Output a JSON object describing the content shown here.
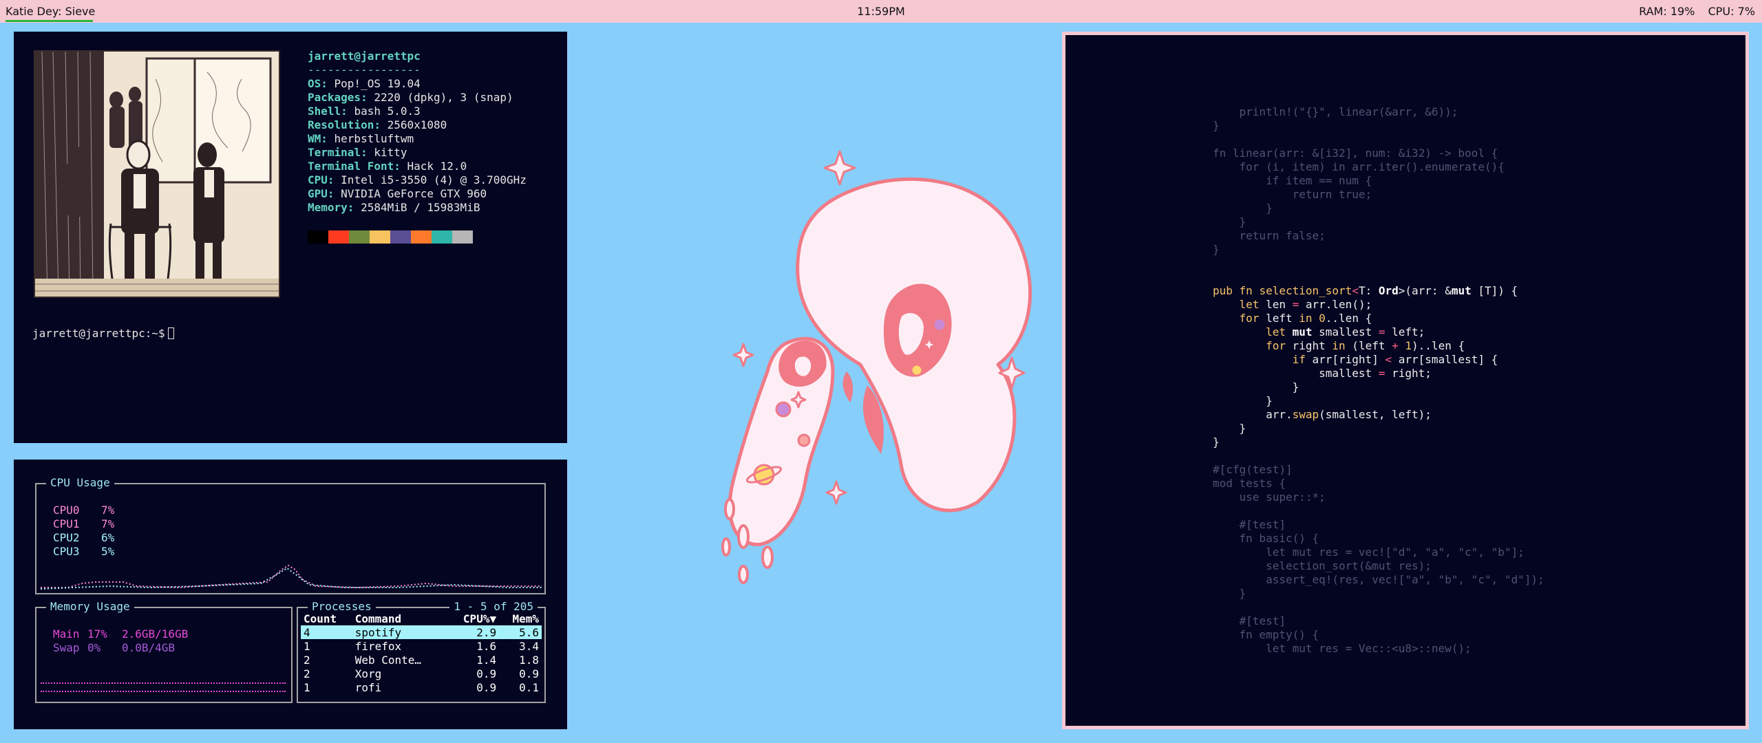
{
  "topbar": {
    "window_title": "Katie Dey: Sieve",
    "clock": "11:59PM",
    "ram": "RAM: 19%",
    "cpu": "CPU:  7%"
  },
  "neofetch": {
    "user_host": "jarrett@jarrettpc",
    "separator": "-----------------",
    "fields": [
      {
        "key": "OS",
        "value": "Pop!_OS 19.04"
      },
      {
        "key": "Packages",
        "value": "2220 (dpkg), 3 (snap)"
      },
      {
        "key": "Shell",
        "value": "bash 5.0.3"
      },
      {
        "key": "Resolution",
        "value": "2560x1080"
      },
      {
        "key": "WM",
        "value": "herbstluftwm"
      },
      {
        "key": "Terminal",
        "value": "kitty"
      },
      {
        "key": "Terminal Font",
        "value": "Hack 12.0"
      },
      {
        "key": "CPU",
        "value": "Intel i5-3550 (4) @ 3.700GHz"
      },
      {
        "key": "GPU",
        "value": "NVIDIA GeForce GTX 960"
      },
      {
        "key": "Memory",
        "value": "2584MiB / 15983MiB"
      }
    ],
    "palette": [
      "#000000",
      "#ff3b1f",
      "#6f8a3a",
      "#f6c35f",
      "#5a4e94",
      "#ff7a2a",
      "#2fb6a8",
      "#b6b6b6"
    ],
    "prompt": "jarrett@jarrettpc:~$"
  },
  "gotop": {
    "cpu_title": "CPU Usage",
    "cpus": [
      {
        "name": "CPU0",
        "value": "7%",
        "color": "#ff8ad3"
      },
      {
        "name": "CPU1",
        "value": "7%",
        "color": "#ff8ad3"
      },
      {
        "name": "CPU2",
        "value": "6%",
        "color": "#a5f2fa"
      },
      {
        "name": "CPU3",
        "value": "5%",
        "color": "#a5f2fa"
      }
    ],
    "mem_title": "Memory Usage",
    "mem": [
      {
        "name": "Main",
        "pct": "17%",
        "amount": "2.6GB/16GB",
        "color": "#e84bd8"
      },
      {
        "name": "Swap",
        "pct": "0%",
        "amount": "0.0B/4GB",
        "color": "#a75ad8"
      }
    ],
    "proc_title": "Processes",
    "proc_range": "1 - 5 of 205",
    "proc_headers": [
      "Count",
      "Command",
      "CPU%▼",
      "Mem%"
    ],
    "procs": [
      {
        "count": "4",
        "command": "spotify",
        "cpu": "2.9",
        "mem": "5.6"
      },
      {
        "count": "1",
        "command": "firefox",
        "cpu": "1.6",
        "mem": "3.4"
      },
      {
        "count": "2",
        "command": "Web Conte…",
        "cpu": "1.4",
        "mem": "1.8"
      },
      {
        "count": "2",
        "command": "Xorg",
        "cpu": "0.9",
        "mem": "0.9"
      },
      {
        "count": "1",
        "command": "rofi",
        "cpu": "0.9",
        "mem": "0.1"
      }
    ]
  },
  "code": {
    "lines": [
      {
        "t": "    println!(\"{}\", linear(&arr, &6));",
        "c": "dim"
      },
      {
        "t": "}",
        "c": "dim"
      },
      {
        "t": "",
        "c": "dim"
      },
      {
        "t": "fn linear(arr: &[i32], num: &i32) -> bool {",
        "c": "dim"
      },
      {
        "t": "    for (i, item) in arr.iter().enumerate(){",
        "c": "dim"
      },
      {
        "t": "        if item == num {",
        "c": "dim"
      },
      {
        "t": "            return true;",
        "c": "dim"
      },
      {
        "t": "        }",
        "c": "dim"
      },
      {
        "t": "    }",
        "c": "dim"
      },
      {
        "t": "    return false;",
        "c": "dim"
      },
      {
        "t": "}",
        "c": "dim"
      },
      {
        "t": "",
        "c": "dim"
      },
      {
        "t": "",
        "c": "dim"
      },
      {
        "t": "pub fn selection_sort<T: Ord>(arr: &mut [T]) {",
        "c": "hl0"
      },
      {
        "t": "    let len = arr.len();",
        "c": "hl1"
      },
      {
        "t": "    for left in 0..len {",
        "c": "hl2"
      },
      {
        "t": "        let mut smallest = left;",
        "c": "hl3"
      },
      {
        "t": "        for right in (left + 1)..len {",
        "c": "hl4"
      },
      {
        "t": "            if arr[right] < arr[smallest] {",
        "c": "hl5"
      },
      {
        "t": "                smallest = right;",
        "c": "hl6"
      },
      {
        "t": "            }",
        "c": "plain"
      },
      {
        "t": "        }",
        "c": "plain"
      },
      {
        "t": "        arr.swap(smallest, left);",
        "c": "hl7"
      },
      {
        "t": "    }",
        "c": "plain"
      },
      {
        "t": "}",
        "c": "plain"
      },
      {
        "t": "",
        "c": "dim"
      },
      {
        "t": "#[cfg(test)]",
        "c": "dim"
      },
      {
        "t": "mod tests {",
        "c": "dim"
      },
      {
        "t": "    use super::*;",
        "c": "dim"
      },
      {
        "t": "",
        "c": "dim"
      },
      {
        "t": "    #[test]",
        "c": "dim"
      },
      {
        "t": "    fn basic() {",
        "c": "dim"
      },
      {
        "t": "        let mut res = vec![\"d\", \"a\", \"c\", \"b\"];",
        "c": "dim"
      },
      {
        "t": "        selection_sort(&mut res);",
        "c": "dim"
      },
      {
        "t": "        assert_eq!(res, vec![\"a\", \"b\", \"c\", \"d\"]);",
        "c": "dim"
      },
      {
        "t": "    }",
        "c": "dim"
      },
      {
        "t": "",
        "c": "dim"
      },
      {
        "t": "    #[test]",
        "c": "dim"
      },
      {
        "t": "    fn empty() {",
        "c": "dim"
      },
      {
        "t": "        let mut res = Vec::<u8>::new();",
        "c": "dim"
      }
    ]
  }
}
